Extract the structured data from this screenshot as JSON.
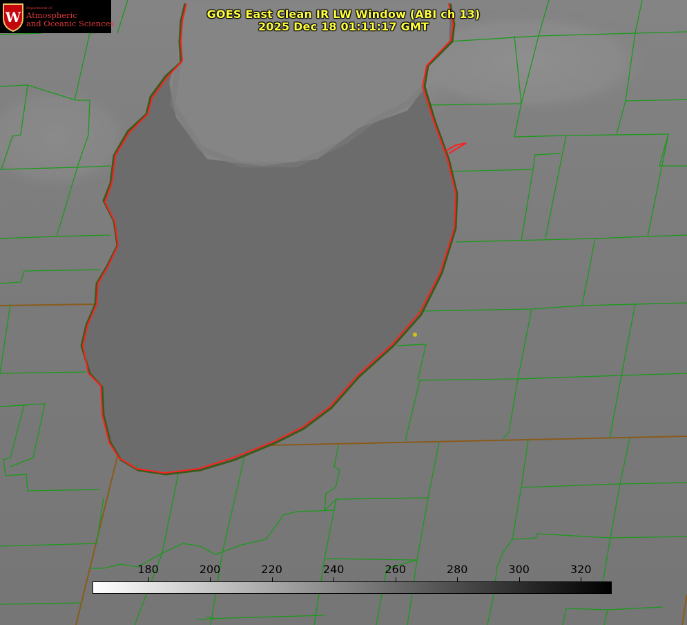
{
  "title": {
    "line1": "GOES East Clean IR LW Window (ABI ch 13)",
    "line2": "2025 Dec 18 01:11:17 GMT"
  },
  "logo": {
    "department": "Department of",
    "line1": "Atmospheric",
    "line2": "and Oceanic Sciences",
    "crest_letter": "W"
  },
  "colorbar": {
    "min": 162,
    "max": 330,
    "ticks": [
      "180",
      "200",
      "220",
      "240",
      "260",
      "280",
      "300",
      "320"
    ],
    "gradient_start": "#ffffff",
    "gradient_end": "#000000"
  },
  "colors": {
    "land_gray": "#7d7d7d",
    "lake_gray": "#6a6a6a",
    "cloud_gray": "#8f8f8f",
    "county_lines": "#1a9a1a",
    "state_lines": "#8a5a1a",
    "coastline": "#ff2020",
    "title": "#ffff40",
    "marker": "#d4c21a"
  }
}
